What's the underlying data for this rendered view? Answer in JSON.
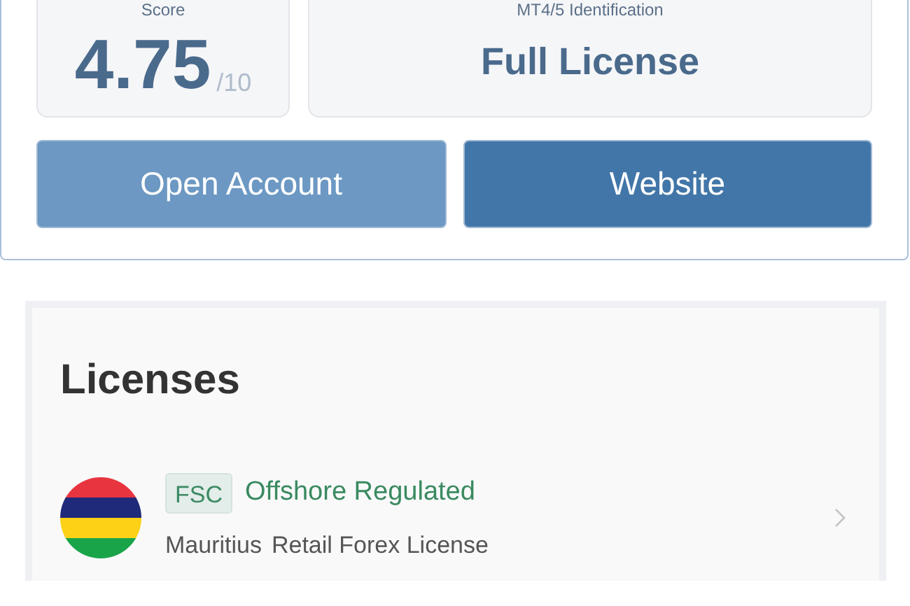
{
  "summary": {
    "score_label": "Score",
    "score": "4.75",
    "score_max": "/10",
    "identification_label": "MT4/5 Identification",
    "identification": "Full License"
  },
  "buttons": [
    {
      "label": "Open Account",
      "kind": "secondary"
    },
    {
      "label": "Website",
      "kind": "primary"
    }
  ],
  "licenses": {
    "title": "Licenses",
    "items": [
      {
        "badge": "FSC",
        "status": "Offshore Regulated",
        "country": "Mauritius",
        "license_type": "Retail Forex License"
      }
    ]
  }
}
